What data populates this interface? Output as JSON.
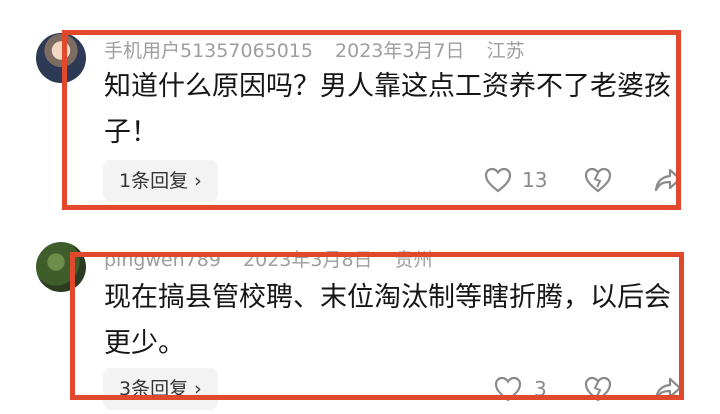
{
  "comments": [
    {
      "username": "手机用户51357065015",
      "date": "2023年3月7日",
      "location": "江苏",
      "text": "知道什么原因吗？男人靠这点工资养不了老婆孩子！",
      "reply_label": "1条回复",
      "likes": "13",
      "avatar_icon": "avatar-photo"
    },
    {
      "username": "pingwen789",
      "date": "2023年3月8日",
      "location": "贵州",
      "text": "现在搞县管校聘、末位淘汰制等瞎折腾，以后会更少。",
      "reply_label": "3条回复",
      "likes": "3",
      "avatar_icon": "avatar-photo"
    }
  ],
  "chevron": "›",
  "highlight_color": "#e2482b"
}
